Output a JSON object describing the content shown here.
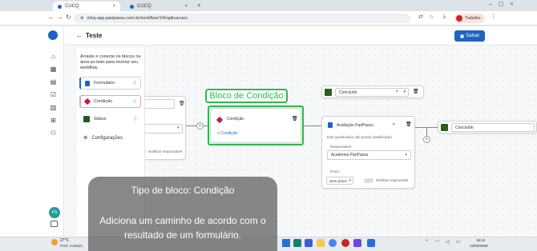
{
  "browser": {
    "tabs": [
      {
        "label": "CUCQ",
        "active": true
      },
      {
        "label": "CUCQ",
        "active": false
      }
    ],
    "url": "clicq-app.paripassu.com.br/workflow/14#aplicacoes",
    "profile_label": "Trabalho"
  },
  "header": {
    "title": "Teste",
    "save_label": "Salvar"
  },
  "side_panel": {
    "instructions": "Arraste e conecte os blocos na área ao lado para montar seu workflow.",
    "blocks": [
      {
        "label": "Formulário",
        "color": "#1e63c4"
      },
      {
        "label": "Condição",
        "color": "#c2185b"
      },
      {
        "label": "Status",
        "color": "#1b5e20"
      }
    ],
    "settings_label": "Configurações"
  },
  "avatar_initials": "FS",
  "highlight_label": "Bloco de Condição",
  "condition_node": {
    "title": "Condição",
    "add_label": "+ Condição"
  },
  "evaluation_node": {
    "title": "Avaliação PariPassu",
    "warning": "Este questionário não possui classificação.",
    "responsible_label": "Responsável",
    "responsible_value": "Academia PariPassu",
    "deadline_label": "Prazo",
    "deadline_value": "Sem prazo",
    "notify_label": "Notificar responsável"
  },
  "left_node": {
    "notify_label": "Notificar responsável"
  },
  "status_nodes": [
    {
      "label": "Concluído"
    },
    {
      "label": "Concluído"
    }
  ],
  "overlay": {
    "title": "Tipo de bloco: Condição",
    "body": "Adiciona um caminho de acordo com o resultado de um formulário."
  },
  "taskbar": {
    "weather_temp": "27°C",
    "weather_desc": "Pred. nublado",
    "search_placeholder": "Pesquisar",
    "time": "16:24",
    "date": "12/03/2026"
  },
  "colors": {
    "accent": "#1e63c4",
    "highlight_green": "#2db84b",
    "status_green": "#2e5e1a",
    "condition_red": "#c2185b"
  }
}
